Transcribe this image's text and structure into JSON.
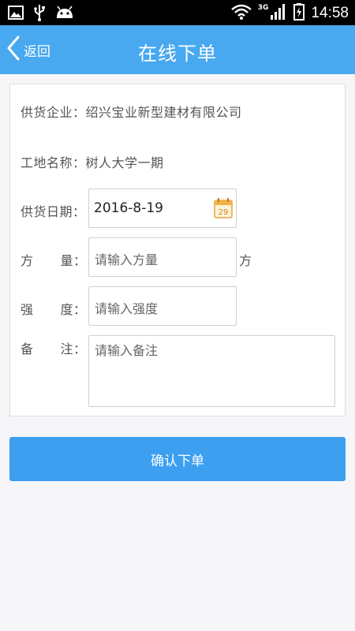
{
  "status_bar": {
    "network": "3G",
    "time": "14:58",
    "icons": [
      "image-icon",
      "usb-icon",
      "android-icon",
      "wifi-icon",
      "signal-icon",
      "battery-icon"
    ]
  },
  "header": {
    "back_label": "返回",
    "title": "在线下单"
  },
  "form": {
    "supplier": {
      "label": "供货企业：",
      "value": "绍兴宝业新型建材有限公司"
    },
    "site": {
      "label": "工地名称：",
      "value": "树人大学一期"
    },
    "date": {
      "label": "供货日期：",
      "value": "2016-8-19",
      "calendar_day": "29"
    },
    "volume": {
      "label_a": "方",
      "label_b": "量：",
      "placeholder": "请输入方量",
      "unit": "方"
    },
    "strength": {
      "label_a": "强",
      "label_b": "度：",
      "placeholder": "请输入强度"
    },
    "remark": {
      "label_a": "备",
      "label_b": "注：",
      "placeholder": "请输入备注"
    }
  },
  "confirm_label": "确认下单",
  "colors": {
    "header_bg": "#48a8f0",
    "button_bg": "#3c9ff0",
    "page_bg": "#f6f6f9"
  }
}
